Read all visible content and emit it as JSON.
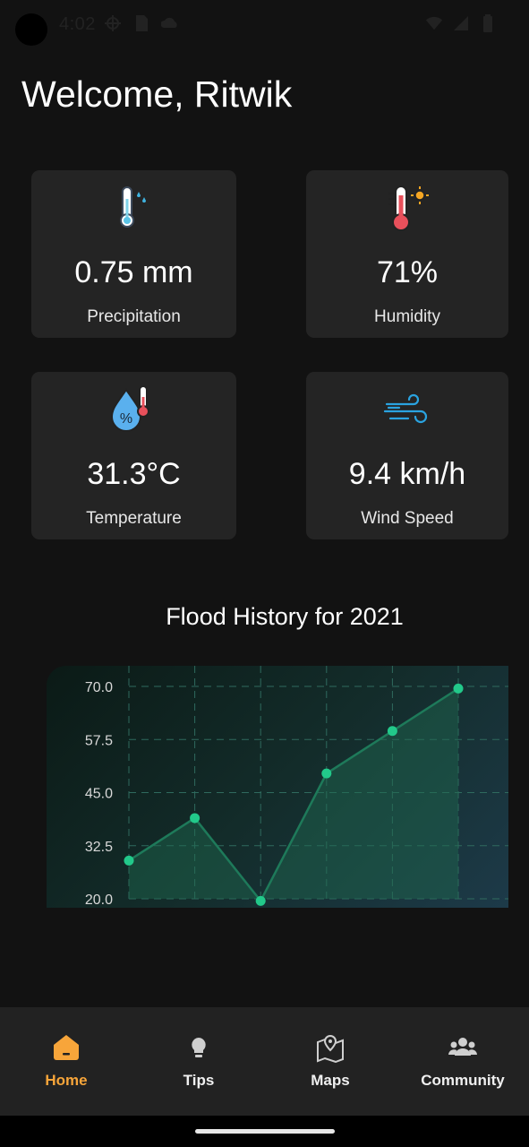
{
  "status_bar": {
    "time": "4:02"
  },
  "header": {
    "welcome": "Welcome, Ritwik"
  },
  "cards": [
    {
      "value": "0.75 mm",
      "label": "Precipitation",
      "icon": "thermometer-rain-icon"
    },
    {
      "value": "71%",
      "label": "Humidity",
      "icon": "thermometer-sun-icon"
    },
    {
      "value": "31.3°C",
      "label": "Temperature",
      "icon": "humidity-drop-icon"
    },
    {
      "value": "9.4 km/h",
      "label": "Wind Speed",
      "icon": "wind-icon"
    }
  ],
  "chart_title": "Flood History for 2021",
  "chart_data": {
    "type": "line",
    "title": "Flood History for 2021",
    "x": [
      0,
      1,
      2,
      3,
      4,
      5
    ],
    "values": [
      29,
      39,
      19.5,
      49.5,
      59.5,
      69.5
    ],
    "ylim": [
      20,
      70
    ],
    "y_ticks": [
      "20.0",
      "32.5",
      "45.0",
      "57.5",
      "70.0"
    ],
    "grid": true,
    "line_color": "#1e7a5a",
    "point_color": "#22c98a"
  },
  "nav": {
    "items": [
      {
        "label": "Home",
        "icon": "home-icon",
        "active": true
      },
      {
        "label": "Tips",
        "icon": "lightbulb-icon",
        "active": false
      },
      {
        "label": "Maps",
        "icon": "map-pin-icon",
        "active": false
      },
      {
        "label": "Community",
        "icon": "people-icon",
        "active": false
      }
    ],
    "active_color": "#f7a53a"
  }
}
